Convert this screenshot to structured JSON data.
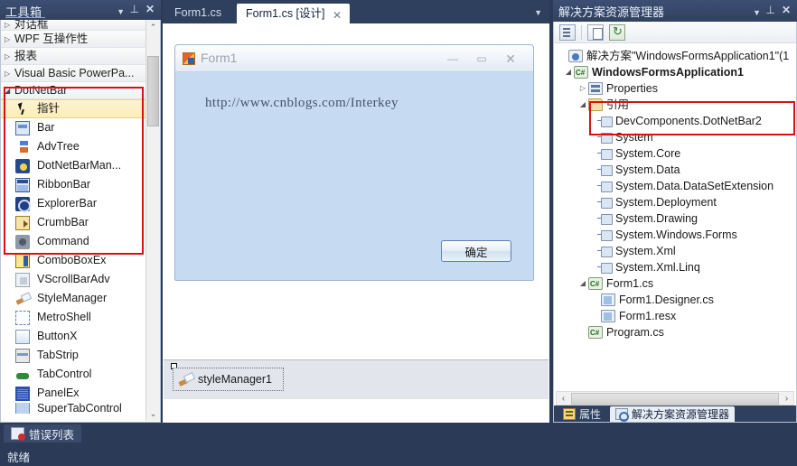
{
  "toolbox": {
    "title": "工具箱",
    "header_buttons": [
      {
        "name": "dropdown",
        "glyph": "▼"
      },
      {
        "name": "pin",
        "glyph": "⊥"
      },
      {
        "name": "close",
        "glyph": "✕"
      }
    ],
    "categories_top": [
      {
        "label": "对话框",
        "expanded": false
      },
      {
        "label": "WPF 互操作性",
        "expanded": false
      },
      {
        "label": "报表",
        "expanded": false
      },
      {
        "label": "Visual Basic PowerPa...",
        "expanded": false
      },
      {
        "label": "DotNetBar",
        "expanded": true
      }
    ],
    "items": [
      {
        "label": "指针",
        "icon": "pointer-icon",
        "selected": true
      },
      {
        "label": "Bar",
        "icon": "bar-icon",
        "selected": false
      },
      {
        "label": "AdvTree",
        "icon": "advtree-icon",
        "selected": false
      },
      {
        "label": "DotNetBarMan...",
        "icon": "dotnetbarmanager-icon",
        "selected": false
      },
      {
        "label": "RibbonBar",
        "icon": "ribbonbar-icon",
        "selected": false
      },
      {
        "label": "ExplorerBar",
        "icon": "explorerbar-icon",
        "selected": false
      },
      {
        "label": "CrumbBar",
        "icon": "crumbbar-icon",
        "selected": false
      },
      {
        "label": "Command",
        "icon": "command-icon",
        "selected": false
      },
      {
        "label": "ComboBoxEx",
        "icon": "comboboxex-icon",
        "selected": false
      },
      {
        "label": "VScrollBarAdv",
        "icon": "vscrollbaradv-icon",
        "selected": false
      },
      {
        "label": "StyleManager",
        "icon": "stylemanager-icon",
        "selected": false
      },
      {
        "label": "MetroShell",
        "icon": "metroshell-icon",
        "selected": false
      },
      {
        "label": "ButtonX",
        "icon": "buttonx-icon",
        "selected": false
      },
      {
        "label": "TabStrip",
        "icon": "tabstrip-icon",
        "selected": false
      },
      {
        "label": "TabControl",
        "icon": "tabcontrol-icon",
        "selected": false
      },
      {
        "label": "PanelEx",
        "icon": "panelex-icon",
        "selected": false
      },
      {
        "label": "SuperTabControl",
        "icon": "supertabcontrol-icon",
        "selected": false
      }
    ],
    "scrollbar": {
      "up": "⌃",
      "down": "⌄"
    },
    "highlight_color": "#d81212"
  },
  "editor": {
    "tabs": [
      {
        "label": "Form1.cs",
        "active": false
      },
      {
        "label": "Form1.cs [设计]",
        "active": true,
        "close_glyph": "✕"
      }
    ],
    "overflow_glyph": "▼"
  },
  "form_designer": {
    "window": {
      "title": "Form1",
      "icon": "form-icon",
      "buttons": [
        {
          "name": "minimize",
          "glyph": "—"
        },
        {
          "name": "maximize",
          "glyph": "▭"
        },
        {
          "name": "close",
          "glyph": "✕"
        }
      ],
      "link_text": "http://www.cnblogs.com/Interkey",
      "ok_button": "确定"
    },
    "tray": {
      "component": "styleManager1",
      "icon": "stylemanager-icon"
    }
  },
  "solution_explorer": {
    "title": "解决方案资源管理器",
    "header_buttons": [
      {
        "name": "dropdown",
        "glyph": "▼"
      },
      {
        "name": "pin",
        "glyph": "⊥"
      },
      {
        "name": "close",
        "glyph": "✕"
      }
    ],
    "toolbar": [
      {
        "name": "properties-button",
        "icon": "properties-icon"
      },
      {
        "name": "show-all-files-button",
        "icon": "show-all-files-icon"
      },
      {
        "name": "refresh-button",
        "icon": "refresh-icon"
      }
    ],
    "tree": [
      {
        "label": "解决方案\"WindowsFormsApplication1\"(1",
        "indent": 0,
        "tri": "",
        "icon": "solution-icon",
        "bold": false
      },
      {
        "label": "WindowsFormsApplication1",
        "indent": 1,
        "tri": "◢",
        "icon": "project-icon",
        "bold": true
      },
      {
        "label": "Properties",
        "indent": 2,
        "tri": "▷",
        "icon": "properties-folder-icon",
        "bold": false
      },
      {
        "label": "引用",
        "indent": 2,
        "tri": "◢",
        "icon": "folder-icon",
        "bold": false
      },
      {
        "label": "DevComponents.DotNetBar2",
        "indent": 4,
        "tri": "",
        "icon": "reference-icon",
        "bold": false
      },
      {
        "label": "System",
        "indent": 4,
        "tri": "",
        "icon": "reference-icon",
        "bold": false
      },
      {
        "label": "System.Core",
        "indent": 4,
        "tri": "",
        "icon": "reference-icon",
        "bold": false
      },
      {
        "label": "System.Data",
        "indent": 4,
        "tri": "",
        "icon": "reference-icon",
        "bold": false
      },
      {
        "label": "System.Data.DataSetExtension",
        "indent": 4,
        "tri": "",
        "icon": "reference-icon",
        "bold": false
      },
      {
        "label": "System.Deployment",
        "indent": 4,
        "tri": "",
        "icon": "reference-icon",
        "bold": false
      },
      {
        "label": "System.Drawing",
        "indent": 4,
        "tri": "",
        "icon": "reference-icon",
        "bold": false
      },
      {
        "label": "System.Windows.Forms",
        "indent": 4,
        "tri": "",
        "icon": "reference-icon",
        "bold": false
      },
      {
        "label": "System.Xml",
        "indent": 4,
        "tri": "",
        "icon": "reference-icon",
        "bold": false
      },
      {
        "label": "System.Xml.Linq",
        "indent": 4,
        "tri": "",
        "icon": "reference-icon",
        "bold": false
      },
      {
        "label": "Form1.cs",
        "indent": 2,
        "tri": "◢",
        "icon": "csharp-file-icon",
        "bold": false
      },
      {
        "label": "Form1.Designer.cs",
        "indent": 4,
        "tri": "",
        "icon": "designer-file-icon",
        "bold": false
      },
      {
        "label": "Form1.resx",
        "indent": 4,
        "tri": "",
        "icon": "designer-file-icon",
        "bold": false
      },
      {
        "label": "Program.cs",
        "indent": 2,
        "tri": "",
        "icon": "csharp-file-icon",
        "bold": false
      }
    ],
    "hscroll": {
      "left": "‹",
      "right": "›"
    },
    "bottom_tabs": [
      {
        "label": "属性",
        "active": false,
        "icon": "properties-icon"
      },
      {
        "label": "解决方案资源管理器",
        "active": true,
        "icon": "solution-explorer-icon"
      }
    ],
    "highlight_color": "#d81212"
  },
  "bottom": {
    "error_list_tab": "错误列表",
    "error_list_icon": "error-list-icon",
    "status_text": "就绪"
  }
}
